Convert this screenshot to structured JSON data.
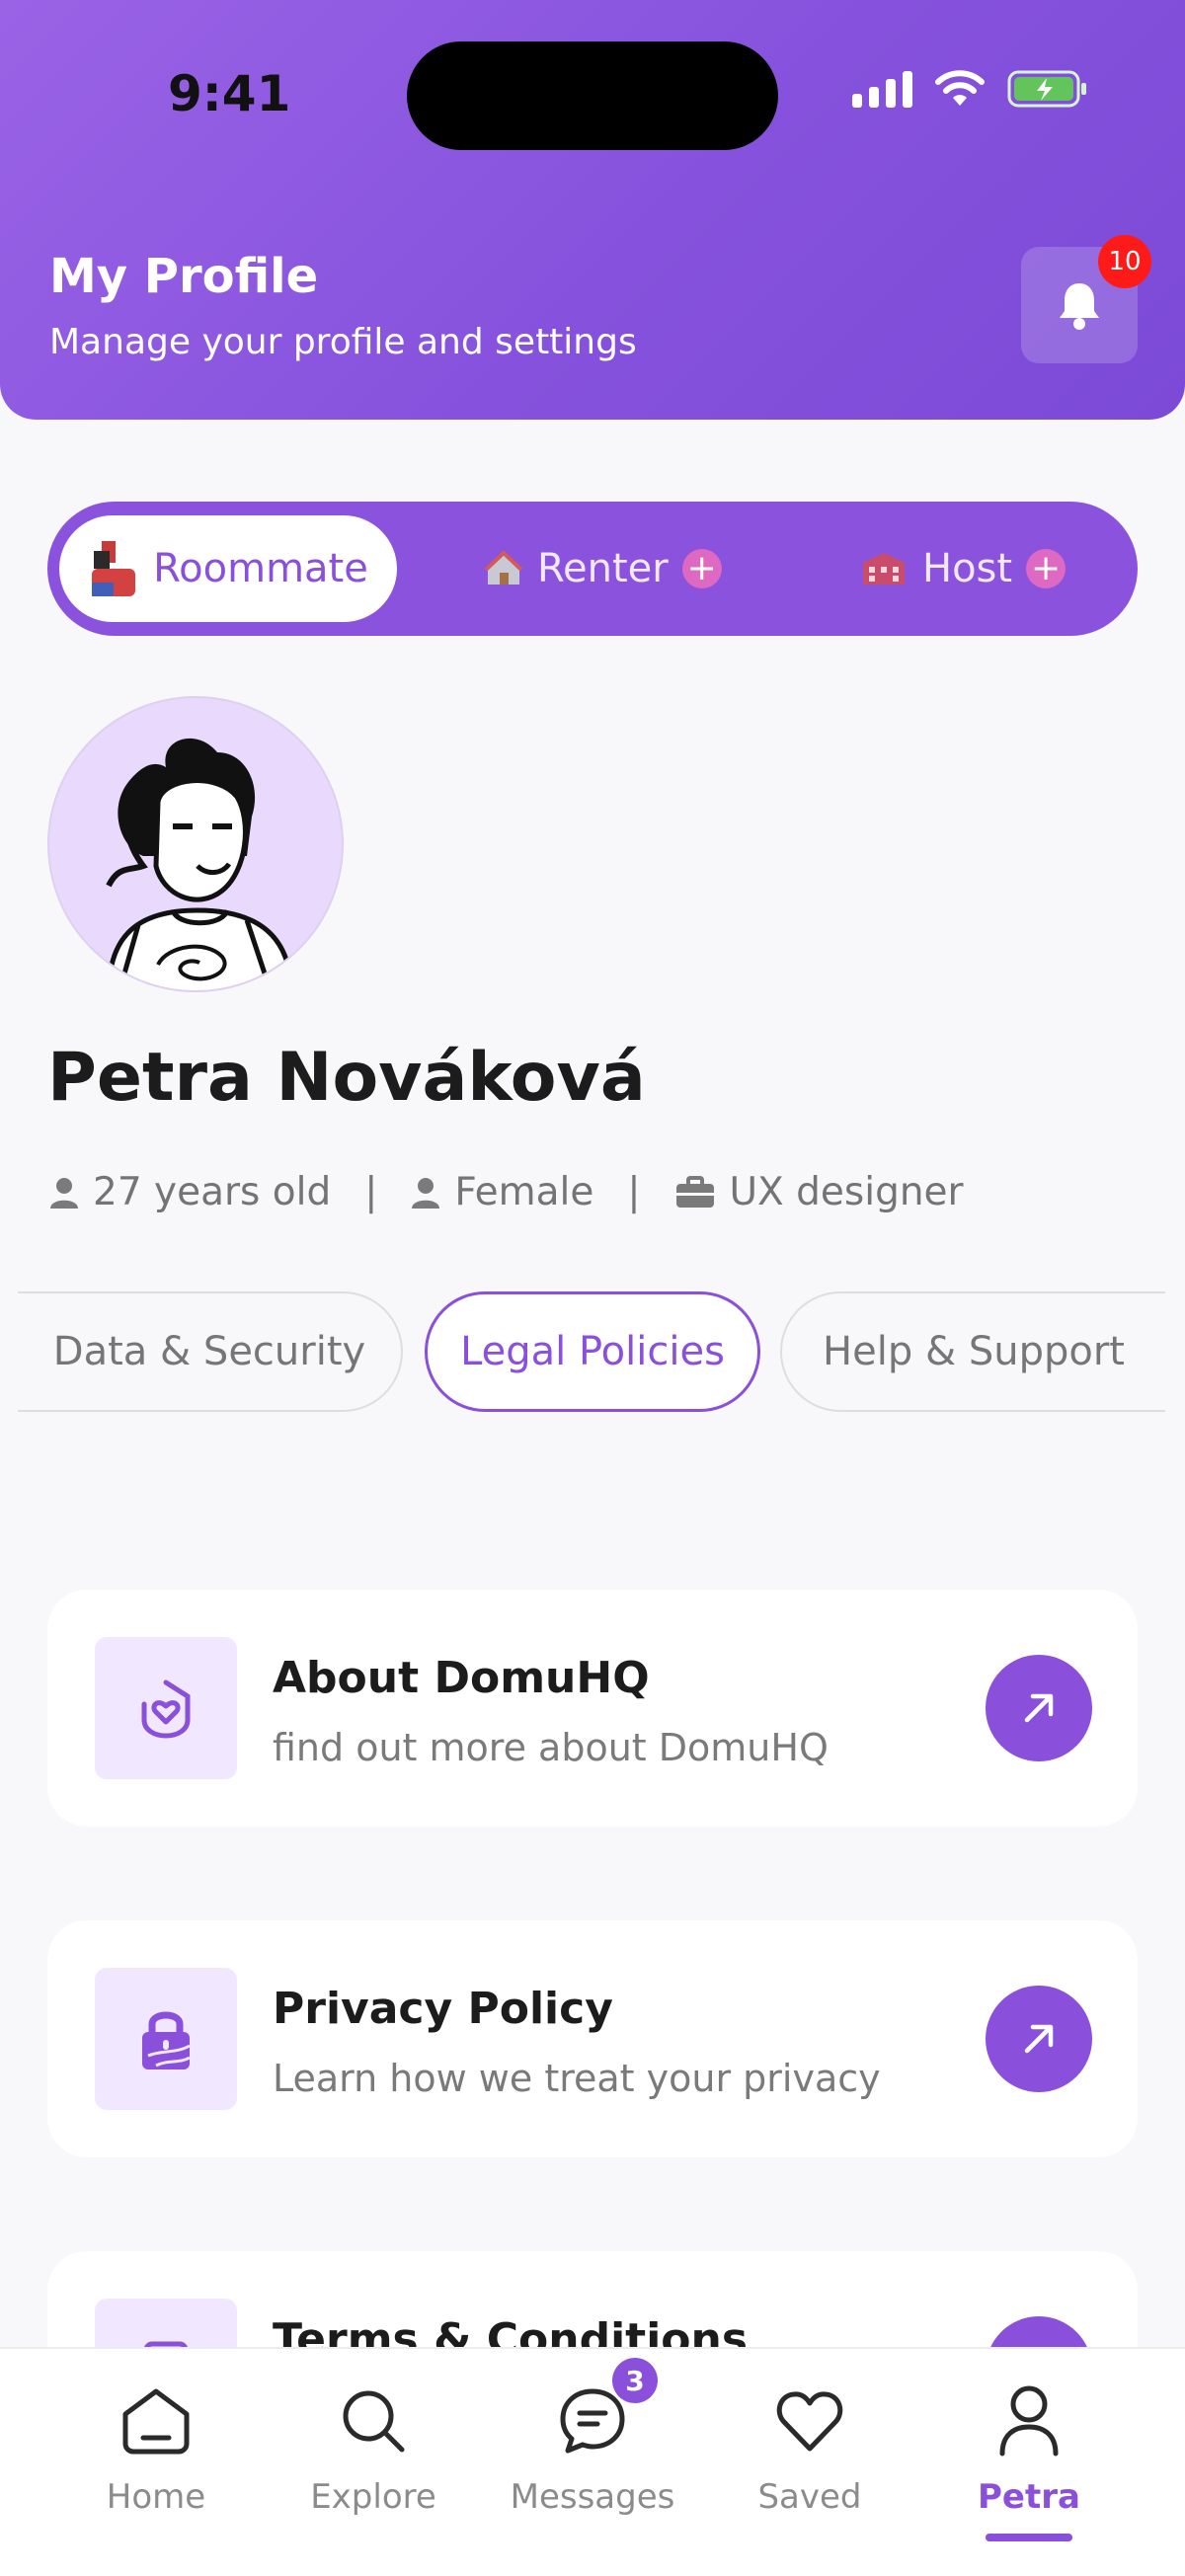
{
  "status_bar": {
    "time": "9:41"
  },
  "header": {
    "title": "My Profile",
    "subtitle": "Manage your profile and settings",
    "notification_count": "10"
  },
  "roles": [
    {
      "label": "Roommate",
      "icon": "roommate-icon",
      "active": true
    },
    {
      "label": "Renter",
      "icon": "house-icon",
      "active": false
    },
    {
      "label": "Host",
      "icon": "building-icon",
      "active": false
    }
  ],
  "profile": {
    "name": "Petra Nováková",
    "age": "27 years old",
    "gender": "Female",
    "job": "UX designer"
  },
  "chips": [
    {
      "label": "Data & Security",
      "active": false
    },
    {
      "label": "Legal Policies",
      "active": true
    },
    {
      "label": "Help & Support",
      "active": false
    }
  ],
  "cards": [
    {
      "title": "About DomuHQ",
      "subtitle": "find out more about DomuHQ",
      "icon": "domuhq-logo-icon"
    },
    {
      "title": "Privacy Policy",
      "subtitle": "Learn how we treat your privacy",
      "icon": "lock-icon"
    },
    {
      "title": "Terms & Conditions",
      "subtitle": "",
      "icon": "document-icon"
    }
  ],
  "tabbar": {
    "items": [
      {
        "label": "Home",
        "icon": "home-icon"
      },
      {
        "label": "Explore",
        "icon": "search-icon"
      },
      {
        "label": "Messages",
        "icon": "chat-icon",
        "badge": "3"
      },
      {
        "label": "Saved",
        "icon": "heart-icon"
      },
      {
        "label": "Petra",
        "icon": "user-icon",
        "active": true
      }
    ]
  },
  "colors": {
    "accent": "#8a4fdb",
    "header": "#8652dd",
    "badge": "#ff1a1a"
  }
}
